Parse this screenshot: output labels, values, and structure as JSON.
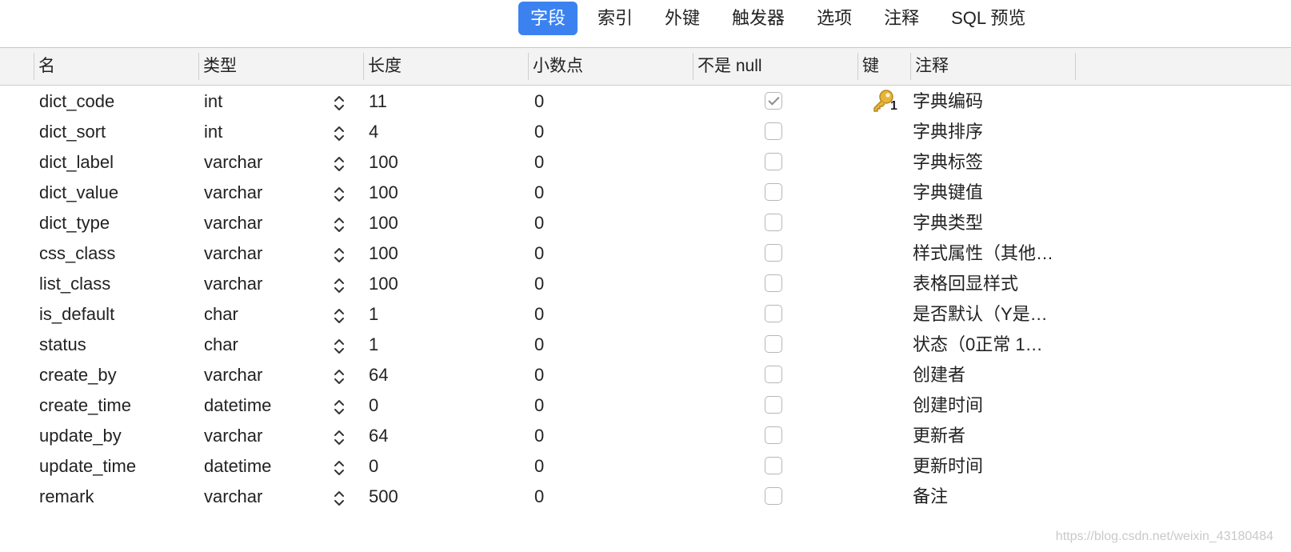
{
  "tabs": [
    {
      "label": "字段",
      "active": true
    },
    {
      "label": "索引",
      "active": false
    },
    {
      "label": "外键",
      "active": false
    },
    {
      "label": "触发器",
      "active": false
    },
    {
      "label": "选项",
      "active": false
    },
    {
      "label": "注释",
      "active": false
    },
    {
      "label": "SQL 预览",
      "active": false
    }
  ],
  "columns": {
    "name": "名",
    "type": "类型",
    "length": "长度",
    "decimal": "小数点",
    "not_null": "不是 null",
    "key": "键",
    "comment": "注释"
  },
  "rows": [
    {
      "name": "dict_code",
      "type": "int",
      "length": "11",
      "decimal": "0",
      "not_null": true,
      "key": "1",
      "comment": "字典编码"
    },
    {
      "name": "dict_sort",
      "type": "int",
      "length": "4",
      "decimal": "0",
      "not_null": false,
      "key": "",
      "comment": "字典排序"
    },
    {
      "name": "dict_label",
      "type": "varchar",
      "length": "100",
      "decimal": "0",
      "not_null": false,
      "key": "",
      "comment": "字典标签"
    },
    {
      "name": "dict_value",
      "type": "varchar",
      "length": "100",
      "decimal": "0",
      "not_null": false,
      "key": "",
      "comment": "字典键值"
    },
    {
      "name": "dict_type",
      "type": "varchar",
      "length": "100",
      "decimal": "0",
      "not_null": false,
      "key": "",
      "comment": "字典类型"
    },
    {
      "name": "css_class",
      "type": "varchar",
      "length": "100",
      "decimal": "0",
      "not_null": false,
      "key": "",
      "comment": "样式属性（其他…"
    },
    {
      "name": "list_class",
      "type": "varchar",
      "length": "100",
      "decimal": "0",
      "not_null": false,
      "key": "",
      "comment": "表格回显样式"
    },
    {
      "name": "is_default",
      "type": "char",
      "length": "1",
      "decimal": "0",
      "not_null": false,
      "key": "",
      "comment": "是否默认（Y是…"
    },
    {
      "name": "status",
      "type": "char",
      "length": "1",
      "decimal": "0",
      "not_null": false,
      "key": "",
      "comment": "状态（0正常 1…"
    },
    {
      "name": "create_by",
      "type": "varchar",
      "length": "64",
      "decimal": "0",
      "not_null": false,
      "key": "",
      "comment": "创建者"
    },
    {
      "name": "create_time",
      "type": "datetime",
      "length": "0",
      "decimal": "0",
      "not_null": false,
      "key": "",
      "comment": "创建时间"
    },
    {
      "name": "update_by",
      "type": "varchar",
      "length": "64",
      "decimal": "0",
      "not_null": false,
      "key": "",
      "comment": "更新者"
    },
    {
      "name": "update_time",
      "type": "datetime",
      "length": "0",
      "decimal": "0",
      "not_null": false,
      "key": "",
      "comment": "更新时间"
    },
    {
      "name": "remark",
      "type": "varchar",
      "length": "500",
      "decimal": "0",
      "not_null": false,
      "key": "",
      "comment": "备注"
    }
  ],
  "watermark": "https://blog.csdn.net/weixin_43180484",
  "colors": {
    "accent": "#3b82f0",
    "key_icon": "#e0a52a"
  },
  "icons": {
    "type_stepper": "updown-chevron-icon",
    "primary_key": "key-icon"
  }
}
